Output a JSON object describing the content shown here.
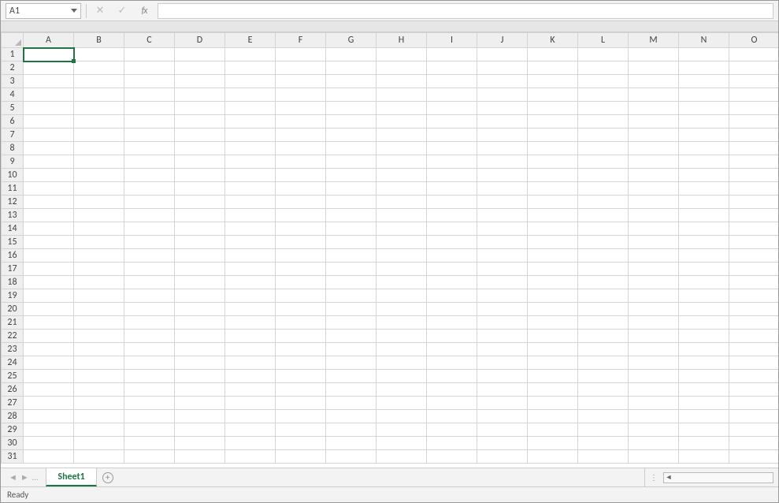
{
  "formula_bar": {
    "name_box_value": "A1",
    "cancel_glyph": "✕",
    "accept_glyph": "✓",
    "fx_label": "fx",
    "formula_value": ""
  },
  "grid": {
    "columns": [
      "A",
      "B",
      "C",
      "D",
      "E",
      "F",
      "G",
      "H",
      "I",
      "J",
      "K",
      "L",
      "M",
      "N",
      "O"
    ],
    "rows": [
      1,
      2,
      3,
      4,
      5,
      6,
      7,
      8,
      9,
      10,
      11,
      12,
      13,
      14,
      15,
      16,
      17,
      18,
      19,
      20,
      21,
      22,
      23,
      24,
      25,
      26,
      27,
      28,
      29,
      30,
      31
    ],
    "active_cell": "A1"
  },
  "tabs": {
    "prev_glyph": "◄",
    "next_glyph": "►",
    "dots_glyph": "…",
    "active_sheet": "Sheet1",
    "add_glyph": "+",
    "scroll_left_glyph": "◄",
    "scroll_right_glyph": "►",
    "options_glyph": "⋮"
  },
  "status": {
    "text": "Ready"
  }
}
